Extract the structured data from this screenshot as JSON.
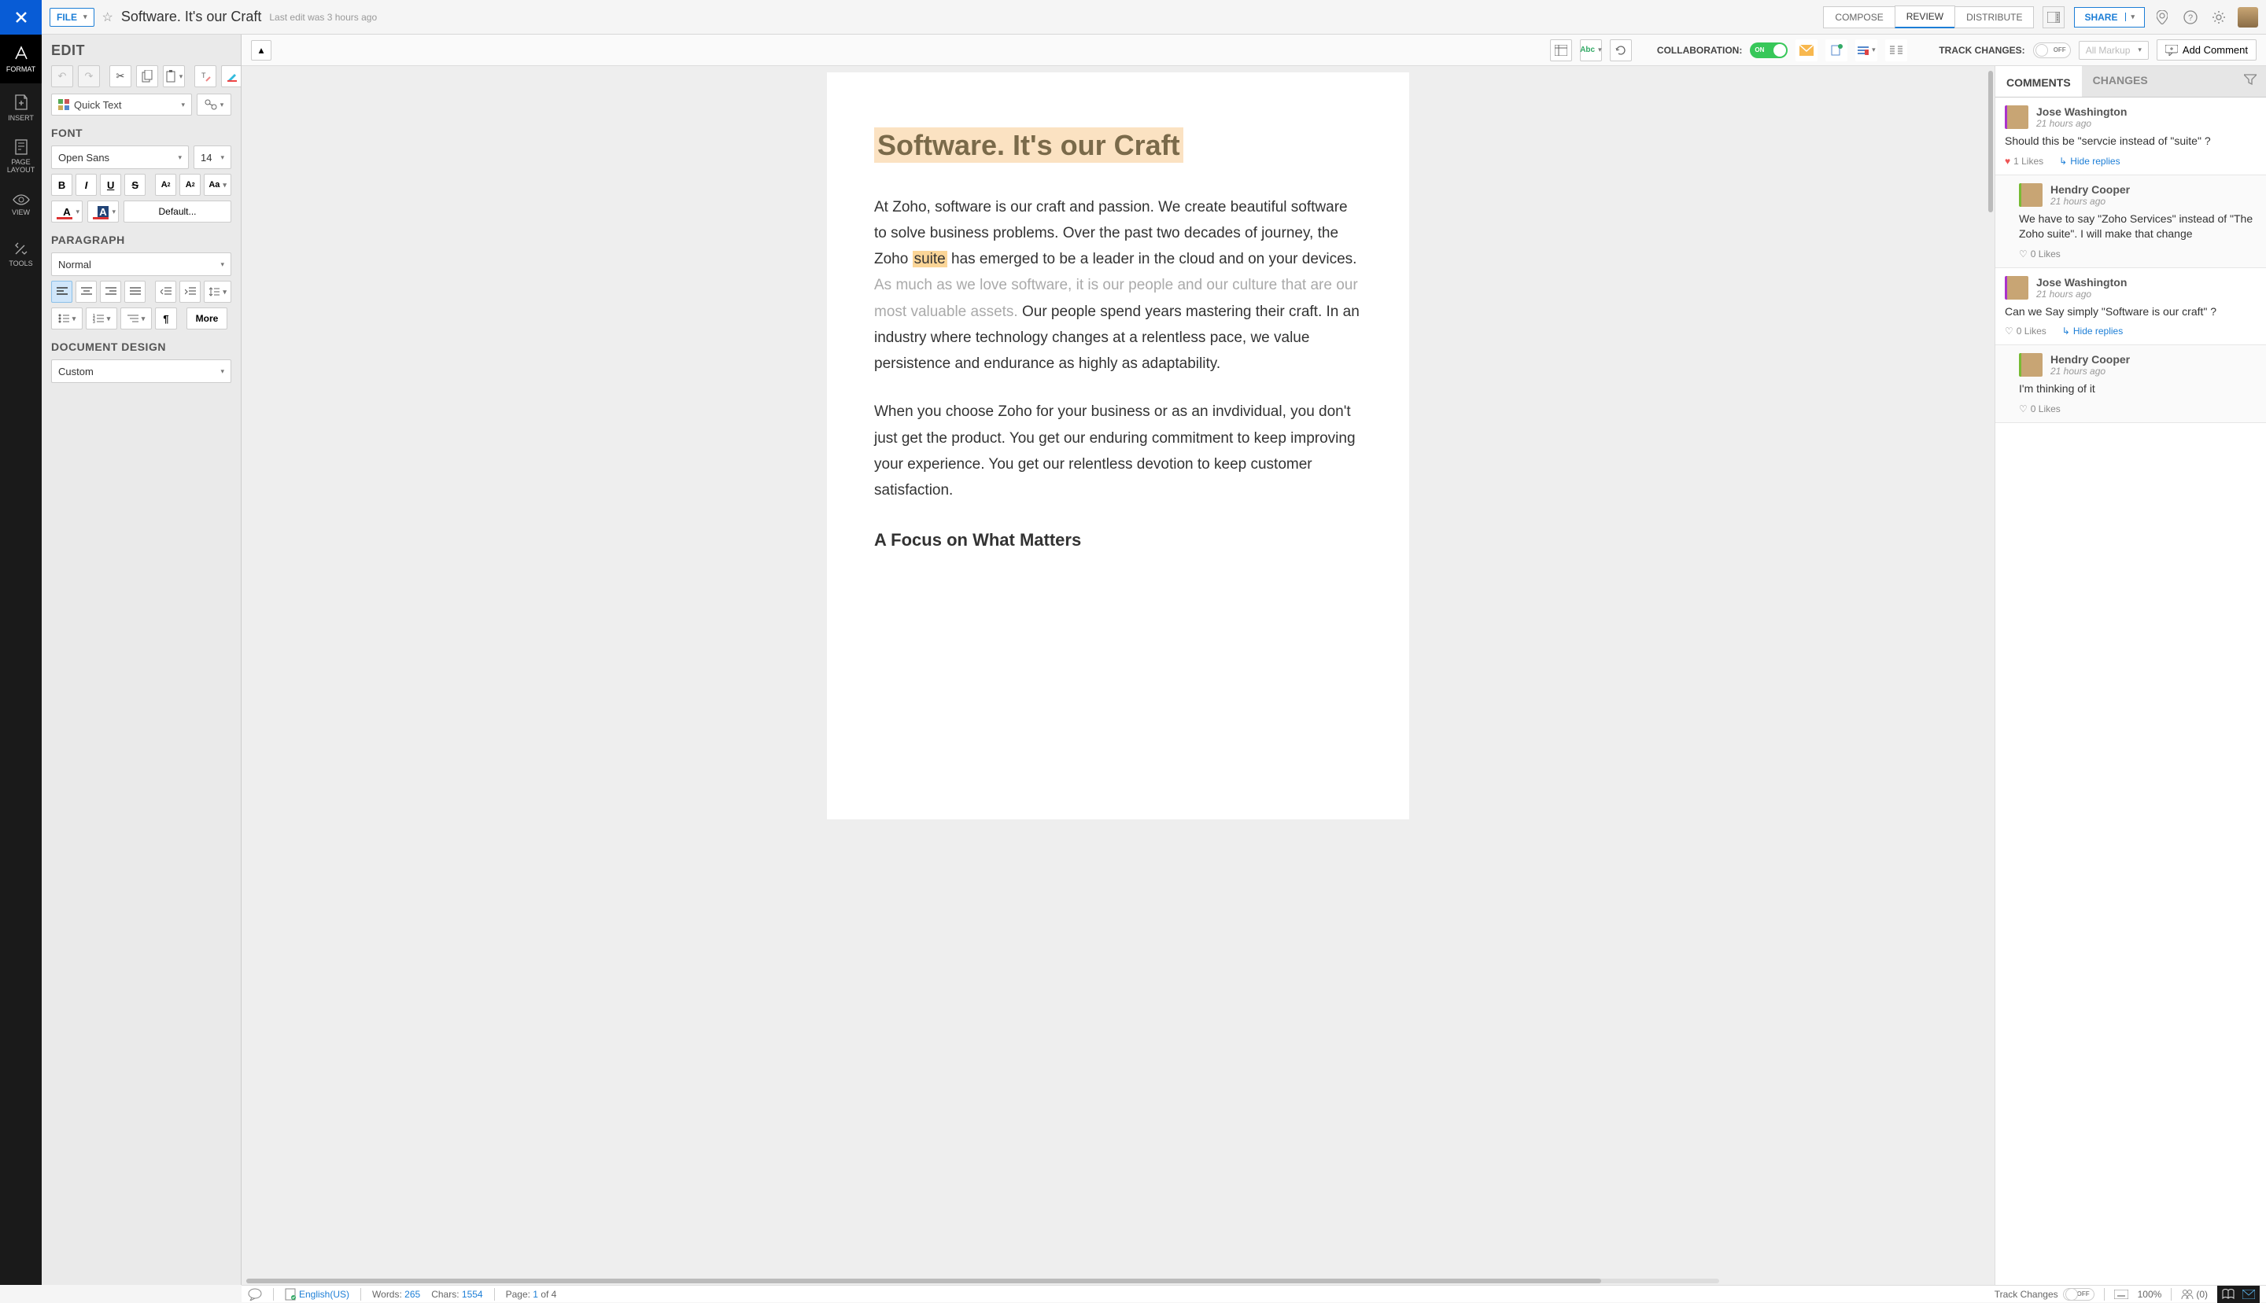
{
  "topbar": {
    "file_label": "FILE",
    "doc_title": "Software. It's our Craft",
    "last_edit": "Last edit was 3 hours ago",
    "compose": "COMPOSE",
    "review": "REVIEW",
    "distribute": "DISTRIBUTE",
    "share": "SHARE"
  },
  "rail": {
    "format": "FORMAT",
    "insert": "INSERT",
    "page_layout": "PAGE\nLAYOUT",
    "view": "VIEW",
    "tools": "TOOLS"
  },
  "left": {
    "edit": "EDIT",
    "quick_text": "Quick Text",
    "font": "FONT",
    "font_name": "Open Sans",
    "font_size": "14",
    "default_btn": "Default...",
    "paragraph": "PARAGRAPH",
    "para_style": "Normal",
    "more": "More",
    "doc_design": "DOCUMENT DESIGN",
    "design_sel": "Custom"
  },
  "toolbar": {
    "collaboration": "COLLABORATION:",
    "on": "ON",
    "track_changes": "TRACK CHANGES:",
    "off": "OFF",
    "all_markup": "All Markup",
    "add_comment": "Add Comment"
  },
  "document": {
    "h1": "Software. It's our Craft",
    "p1_a": "At Zoho, software is our craft and passion. We create beautiful software to solve business problems. Over the past two decades of  journey, the Zoho ",
    "p1_hl": "suite",
    "p1_b": " has emerged to be a leader in the cloud and on your devices.  ",
    "p1_fade": "As much as we love software, it is our people and our culture that are our most valuable assets.",
    "p1_c": "   Our people spend years mastering their  craft. In an industry where technology changes at a relentless pace, we value persistence and endurance as highly as adaptability.",
    "p2": "When you choose Zoho for your business  or as an invdividual, you don't just get the product. You get our enduring commitment to keep improving your experience.  You get our relentless devotion to keep customer satisfaction.",
    "h2": "A Focus on What Matters"
  },
  "right": {
    "tab_comments": "COMMENTS",
    "tab_changes": "CHANGES",
    "comments": [
      {
        "name": "Jose Washington",
        "time": "21 hours ago",
        "body": "Should this be \"servcie instead of \"suite\" ?",
        "likes": "1 Likes",
        "hide": "Hide replies",
        "reply": false,
        "heart": true
      },
      {
        "name": "Hendry Cooper",
        "time": "21 hours ago",
        "body": "We have to say \"Zoho Services\" instead of \"The Zoho suite\". I will make that change",
        "likes": "0 Likes",
        "reply": true
      },
      {
        "name": "Jose Washington",
        "time": "21 hours ago",
        "body": "Can we Say simply \"Software is our craft\" ?",
        "likes": "0 Likes",
        "hide": "Hide replies",
        "reply": false
      },
      {
        "name": "Hendry Cooper",
        "time": "21 hours ago",
        "body": "I'm thinking of it",
        "likes": "0 Likes",
        "reply": true
      }
    ]
  },
  "status": {
    "lang": "English(US)",
    "words_label": "Words:",
    "words": "265",
    "chars_label": "Chars:",
    "chars": "1554",
    "page_label": "Page:",
    "page": "1",
    "of": "of 4",
    "track": "Track Changes",
    "off": "OFF",
    "zoom": "100%",
    "collab": "(0)"
  }
}
